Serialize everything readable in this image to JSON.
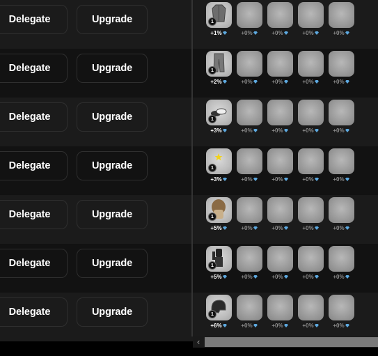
{
  "rows": [
    {
      "delegate_label": "Delegate",
      "upgrade_label": "Upgrade",
      "item": "coat-icon",
      "level": "1",
      "bonuses": [
        "+1%",
        "+0%",
        "+0%",
        "+0%",
        "+0%"
      ]
    },
    {
      "delegate_label": "Delegate",
      "upgrade_label": "Upgrade",
      "item": "trousers-icon",
      "level": "1",
      "bonuses": [
        "+2%",
        "+0%",
        "+0%",
        "+0%",
        "+0%"
      ]
    },
    {
      "delegate_label": "Delegate",
      "upgrade_label": "Upgrade",
      "item": "shoes-icon",
      "level": "1",
      "bonuses": [
        "+3%",
        "+0%",
        "+0%",
        "+0%",
        "+0%"
      ]
    },
    {
      "delegate_label": "Delegate",
      "upgrade_label": "Upgrade",
      "item": "earring-icon",
      "level": "1",
      "bonuses": [
        "+3%",
        "+0%",
        "+0%",
        "+0%",
        "+0%"
      ]
    },
    {
      "delegate_label": "Delegate",
      "upgrade_label": "Upgrade",
      "item": "hair-icon",
      "level": "1",
      "bonuses": [
        "+5%",
        "+0%",
        "+0%",
        "+0%",
        "+0%"
      ]
    },
    {
      "delegate_label": "Delegate",
      "upgrade_label": "Upgrade",
      "item": "outfit-icon",
      "level": "1",
      "bonuses": [
        "+5%",
        "+0%",
        "+0%",
        "+0%",
        "+0%"
      ]
    },
    {
      "delegate_label": "Delegate",
      "upgrade_label": "Upgrade",
      "item": "helmet-icon",
      "level": "1",
      "bonuses": [
        "+6%",
        "+0%",
        "+0%",
        "+0%",
        "+0%"
      ]
    }
  ],
  "colors": {
    "gem": "#5da9e0",
    "row_odd": "#1b1b1b",
    "row_even": "#121212"
  },
  "scrollbar": {
    "left_arrow_icon": "chevron-left-icon",
    "arrow_glyph": "‹"
  }
}
